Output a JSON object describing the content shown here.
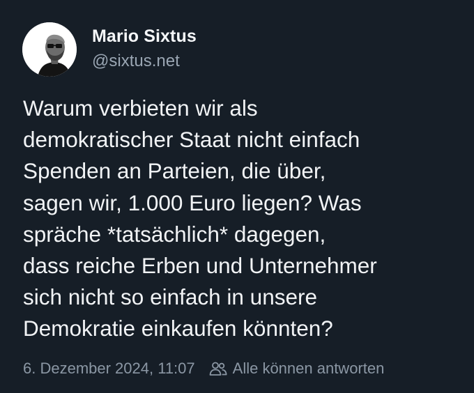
{
  "post": {
    "author": {
      "display_name": "Mario Sixtus",
      "handle": "@sixtus.net",
      "avatar_icon": "person-with-glasses-avatar"
    },
    "text": "Warum verbieten wir als\ndemokratischer Staat nicht einfach\nSpenden an Parteien, die über,\nsagen wir, 1.000 Euro liegen? Was\nspräche *tatsächlich* dagegen,\ndass reiche Erben und Unternehmer\nsich nicht so einfach in unsere\nDemokratie einkaufen könnten?",
    "timestamp": "6. Dezember 2024, 11:07",
    "reply_setting": {
      "icon": "people-icon",
      "label": "Alle können antworten"
    }
  },
  "colors": {
    "background": "#161e27",
    "text_primary": "#f1f3f5",
    "text_secondary": "#8b97a4"
  }
}
